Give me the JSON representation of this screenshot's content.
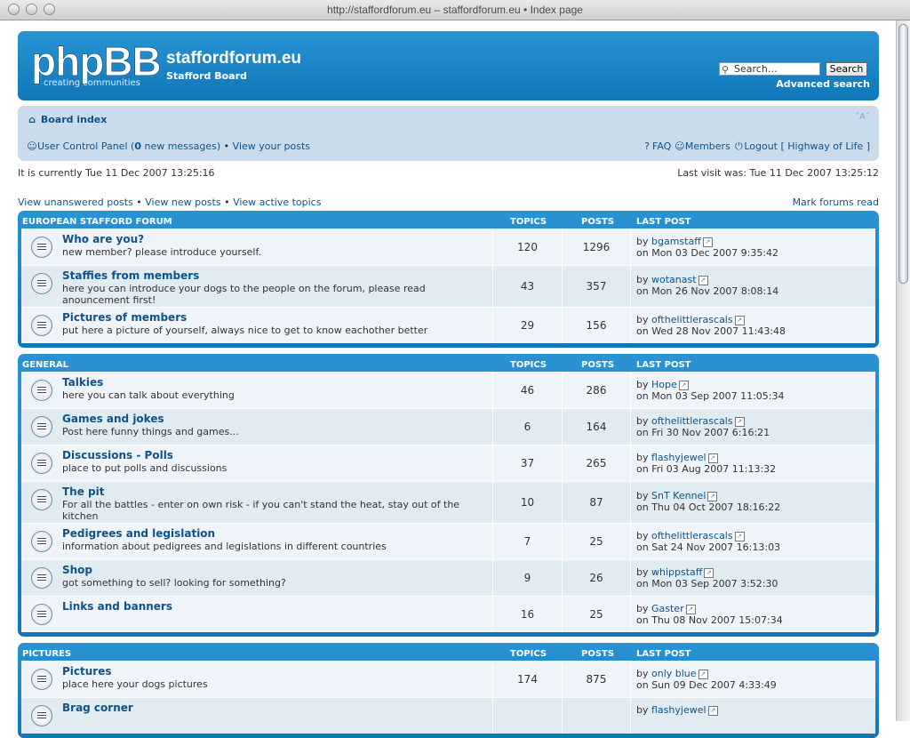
{
  "window": {
    "title": "http://staffordforum.eu – staffordforum.eu • Index page"
  },
  "header": {
    "logo_text": "phpBB",
    "logo_tagline": "creating    communities",
    "site_name": "staffordforum.eu",
    "site_desc": "Stafford Board",
    "search_placeholder": "Search…",
    "search_button": "Search",
    "advanced_search": "Advanced search"
  },
  "navbar": {
    "board_index": "Board index",
    "font_size": "A",
    "ucp": "User Control Panel",
    "new_messages_count": "0",
    "new_messages_text": "new messages",
    "view_posts": "View your posts",
    "faq": "FAQ",
    "members": "Members",
    "logout": "Logout [ Highway of Life ]"
  },
  "info": {
    "current_time": "It is currently Tue 11 Dec 2007 13:25:16",
    "last_visit": "Last visit was: Tue 11 Dec 2007 13:25:12"
  },
  "actions": {
    "unanswered": "View unanswered posts",
    "new_posts": "View new posts",
    "active": "View active topics",
    "mark_read": "Mark forums read"
  },
  "columns": {
    "topics": "TOPICS",
    "posts": "POSTS",
    "last_post": "LAST POST"
  },
  "categories": [
    {
      "name": "EUROPEAN STAFFORD FORUM",
      "forums": [
        {
          "title": "Who are you?",
          "desc": "new member? please introduce yourself.",
          "topics": "120",
          "posts": "1296",
          "last_by": "bgamstaff",
          "last_on": "on Mon 03 Dec 2007 9:35:42"
        },
        {
          "title": "Staffies from members",
          "desc": "here you can introduce your dogs to the people on the forum, please read anouncement first!",
          "topics": "43",
          "posts": "357",
          "last_by": "wotanast",
          "last_on": "on Mon 26 Nov 2007 8:08:14"
        },
        {
          "title": "Pictures of members",
          "desc": "put here a picture of yourself, always nice to get to know eachother better",
          "topics": "29",
          "posts": "156",
          "last_by": "ofthelittlerascals",
          "last_on": "on Wed 28 Nov 2007 11:43:48"
        }
      ]
    },
    {
      "name": "GENERAL",
      "forums": [
        {
          "title": "Talkies",
          "desc": "here you can talk about everything",
          "topics": "46",
          "posts": "286",
          "last_by": "Hope",
          "last_on": "on Mon 03 Sep 2007 11:05:34"
        },
        {
          "title": "Games and jokes",
          "desc": "Post here funny things and games...",
          "topics": "6",
          "posts": "164",
          "last_by": "ofthelittlerascals",
          "last_on": "on Fri 30 Nov 2007 6:16:21"
        },
        {
          "title": "Discussions - Polls",
          "desc": "place to put polls and discussions",
          "topics": "37",
          "posts": "265",
          "last_by": "flashyjewel",
          "last_on": "on Fri 03 Aug 2007 11:13:32"
        },
        {
          "title": "The pit",
          "desc": "For all the battles - enter on own risk - if you can't stand the heat, stay out of the kitchen",
          "topics": "10",
          "posts": "87",
          "last_by": "SnT Kennel",
          "last_on": "on Thu 04 Oct 2007 18:16:22"
        },
        {
          "title": "Pedigrees and legislation",
          "desc": "information about pedigrees and legislations in different countries",
          "topics": "7",
          "posts": "25",
          "last_by": "ofthelittlerascals",
          "last_on": "on Sat 24 Nov 2007 16:13:03"
        },
        {
          "title": "Shop",
          "desc": "got something to sell? looking for something?",
          "topics": "9",
          "posts": "26",
          "last_by": "whippstaff",
          "last_on": "on Mon 03 Sep 2007 3:52:30"
        },
        {
          "title": "Links and banners",
          "desc": "",
          "topics": "16",
          "posts": "25",
          "last_by": "Gaster",
          "last_on": "on Thu 08 Nov 2007 15:07:34"
        }
      ]
    },
    {
      "name": "PICTURES",
      "forums": [
        {
          "title": "Pictures",
          "desc": "place here your dogs pictures",
          "topics": "174",
          "posts": "875",
          "last_by": "only blue",
          "last_on": "on Sun 09 Dec 2007 4:33:49"
        },
        {
          "title": "Brag corner",
          "desc": "",
          "topics": "",
          "posts": "",
          "last_by": "flashyjewel",
          "last_on": ""
        }
      ]
    }
  ],
  "by_prefix": "by "
}
